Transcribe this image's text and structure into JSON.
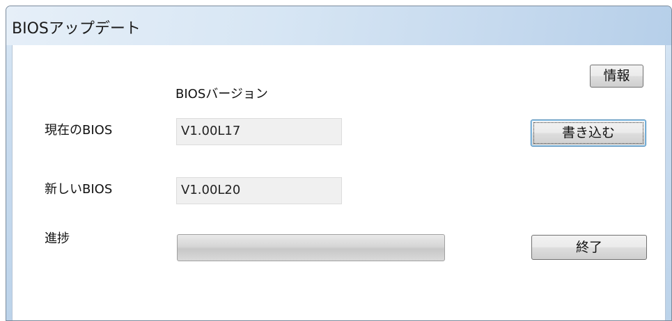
{
  "window": {
    "title": "BIOSアップデート"
  },
  "header": {
    "bios_version_label": "BIOSバージョン"
  },
  "current_bios": {
    "label": "現在のBIOS",
    "value": "V1.00L17"
  },
  "new_bios": {
    "label": "新しいBIOS",
    "value": "V1.00L20"
  },
  "progress": {
    "label": "進捗",
    "value_percent": 0
  },
  "buttons": {
    "info_label": "情報",
    "write_label": "書き込む",
    "exit_label": "終了"
  }
}
